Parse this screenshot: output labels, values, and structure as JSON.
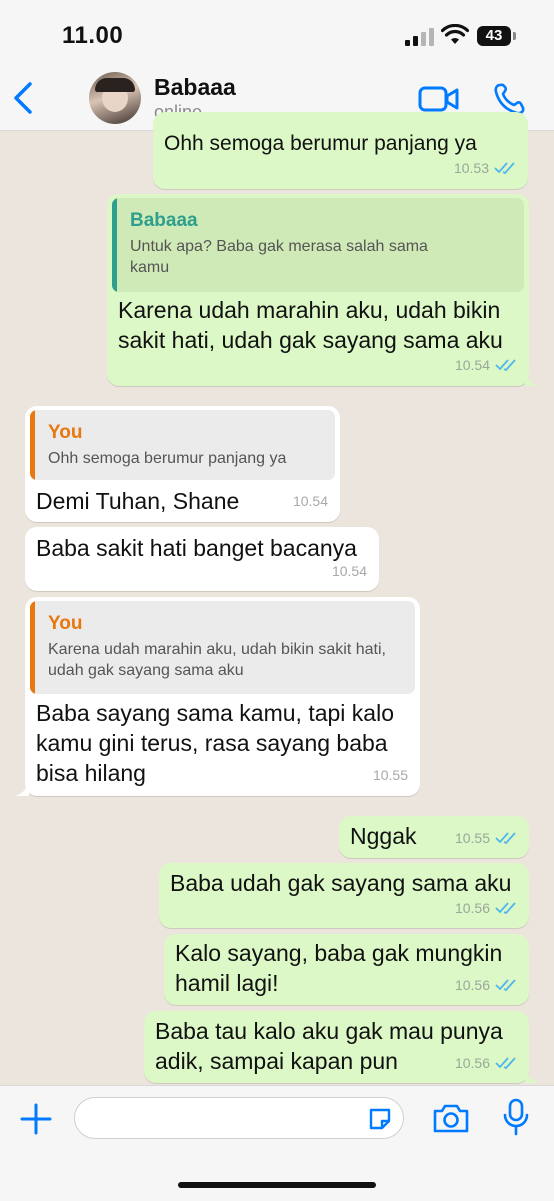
{
  "status_bar": {
    "time": "11.00",
    "battery": "43"
  },
  "header": {
    "contact_name": "Babaaa",
    "contact_status": "online"
  },
  "colors": {
    "accent": "#007aff",
    "outgoing": "#dcf8c6",
    "incoming": "#ffffff",
    "quote_self": "#e8770e",
    "quote_contact": "#2e9e8f",
    "read_tick": "#4fb6ec"
  },
  "messages": [
    {
      "dir": "out",
      "text": "Ohh semoga berumur panjang ya",
      "time": "10.53",
      "status": "read-ticks-icon"
    },
    {
      "dir": "out",
      "quote": {
        "name": "Babaaa",
        "text": "Untuk apa? Baba gak merasa salah sama kamu"
      },
      "text": "Karena udah marahin aku, udah bikin sakit hati, udah gak sayang sama aku",
      "time": "10.54",
      "status": "read-ticks-icon"
    },
    {
      "dir": "in",
      "quote": {
        "name": "You",
        "text": "Ohh semoga berumur panjang ya"
      },
      "text": "Demi Tuhan, Shane",
      "time": "10.54"
    },
    {
      "dir": "in",
      "text": "Baba sakit hati banget bacanya",
      "time": "10.54"
    },
    {
      "dir": "in",
      "quote": {
        "name": "You",
        "text": "Karena udah marahin aku, udah bikin sakit hati, udah gak sayang sama aku"
      },
      "text": "Baba sayang sama kamu, tapi kalo kamu gini terus, rasa sayang baba bisa hilang",
      "time": "10.55"
    },
    {
      "dir": "out",
      "text": "Nggak",
      "time": "10.55",
      "status": "read-ticks-icon"
    },
    {
      "dir": "out",
      "text": "Baba udah gak sayang sama aku",
      "time": "10.56",
      "status": "read-ticks-icon"
    },
    {
      "dir": "out",
      "text": "Kalo sayang, baba gak mungkin hamil lagi!",
      "time": "10.56",
      "status": "read-ticks-icon"
    },
    {
      "dir": "out",
      "text": "Baba tau kalo aku gak mau punya adik, sampai kapan pun",
      "time": "10.56",
      "status": "read-ticks-icon"
    }
  ],
  "composer": {
    "placeholder": ""
  }
}
